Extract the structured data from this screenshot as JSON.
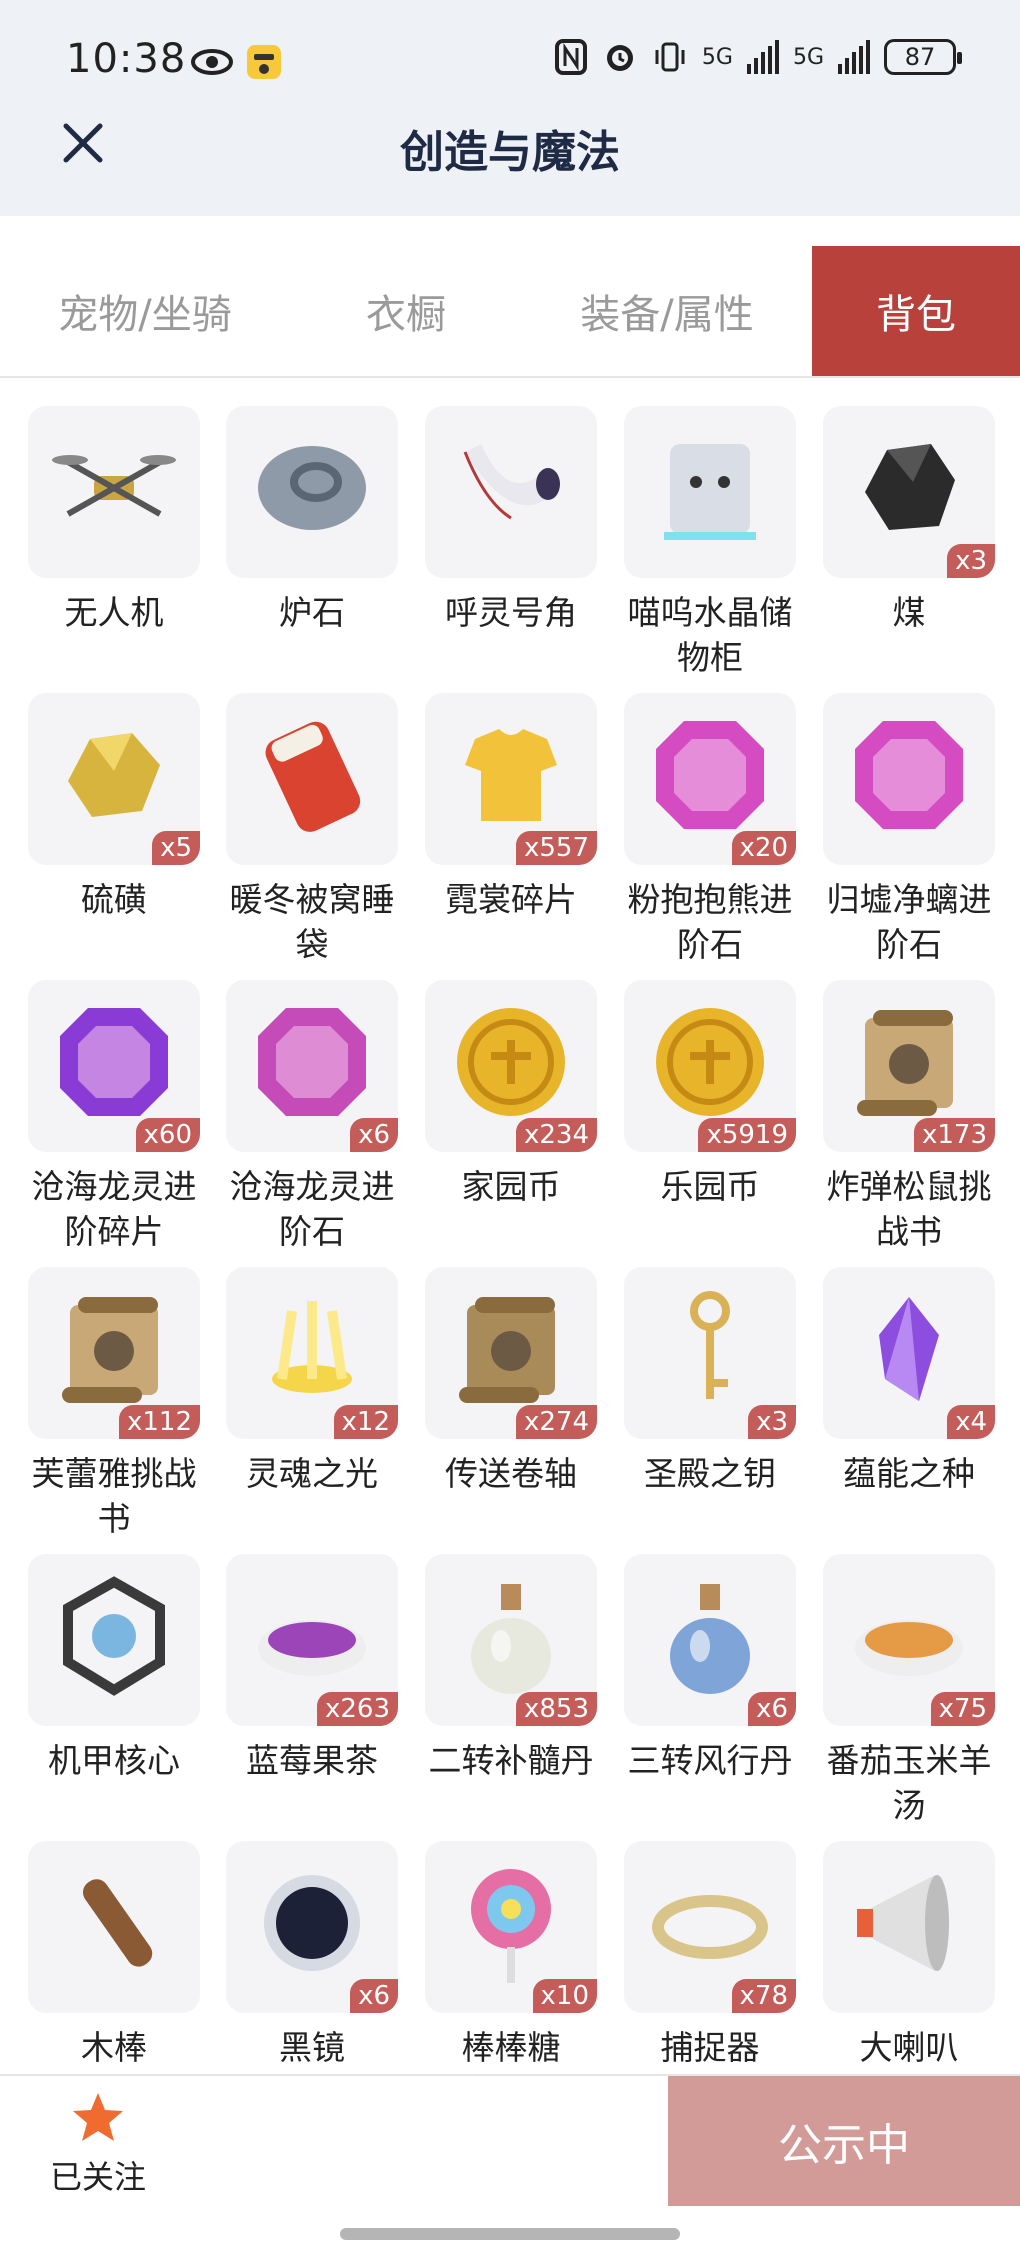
{
  "status_bar": {
    "time": "10:38",
    "battery": "87",
    "network_1": "5G",
    "network_2": "5G"
  },
  "header": {
    "title": "创造与魔法",
    "close_icon": "close-icon"
  },
  "tabs": [
    {
      "label": "宠物/坐骑",
      "active": false
    },
    {
      "label": "衣橱",
      "active": false
    },
    {
      "label": "装备/属性",
      "active": false
    },
    {
      "label": "背包",
      "active": true
    }
  ],
  "items": [
    {
      "name": "无人机",
      "count": "",
      "icon": "drone-icon",
      "color": "#c9a544"
    },
    {
      "name": "炉石",
      "count": "",
      "icon": "hearthstone-icon",
      "color": "#8e9aa8"
    },
    {
      "name": "呼灵号角",
      "count": "",
      "icon": "horn-icon",
      "color": "#b33a3a"
    },
    {
      "name": "喵呜水晶储物柜",
      "count": "",
      "icon": "cat-cabinet-icon",
      "color": "#d8dde6"
    },
    {
      "name": "煤",
      "count": "x3",
      "icon": "coal-icon",
      "color": "#2b2b2b"
    },
    {
      "name": "硫磺",
      "count": "x5",
      "icon": "sulfur-icon",
      "color": "#d7b43d"
    },
    {
      "name": "暖冬被窝睡袋",
      "count": "",
      "icon": "sleeping-bag-icon",
      "color": "#d9432f"
    },
    {
      "name": "霓裳碎片",
      "count": "x557",
      "icon": "clothes-shard-icon",
      "color": "#f2c33a"
    },
    {
      "name": "粉抱抱熊进阶石",
      "count": "x20",
      "icon": "pink-gem-icon",
      "color": "#d54bc2"
    },
    {
      "name": "归墟净螭进阶石",
      "count": "",
      "icon": "pink-gem-icon",
      "color": "#d54bc2"
    },
    {
      "name": "沧海龙灵进阶碎片",
      "count": "x60",
      "icon": "purple-gem-icon",
      "color": "#8a3bd6"
    },
    {
      "name": "沧海龙灵进阶石",
      "count": "x6",
      "icon": "purple-gem-icon",
      "color": "#c44bb8"
    },
    {
      "name": "家园币",
      "count": "x234",
      "icon": "coin-icon",
      "color": "#e8b52a"
    },
    {
      "name": "乐园币",
      "count": "x5919",
      "icon": "coin-icon",
      "color": "#e8b52a"
    },
    {
      "name": "炸弹松鼠挑战书",
      "count": "x173",
      "icon": "wanted-scroll-icon",
      "color": "#c8a877"
    },
    {
      "name": "芙蕾雅挑战书",
      "count": "x112",
      "icon": "wanted-scroll-icon",
      "color": "#c8a877"
    },
    {
      "name": "灵魂之光",
      "count": "x12",
      "icon": "soul-light-icon",
      "color": "#f5d64a"
    },
    {
      "name": "传送卷轴",
      "count": "x274",
      "icon": "teleport-scroll-icon",
      "color": "#a98a59"
    },
    {
      "name": "圣殿之钥",
      "count": "x3",
      "icon": "key-icon",
      "color": "#d9b257"
    },
    {
      "name": "蕴能之种",
      "count": "x4",
      "icon": "crystal-icon",
      "color": "#8d4ee0"
    },
    {
      "name": "机甲核心",
      "count": "",
      "icon": "mech-core-icon",
      "color": "#3a3a3a"
    },
    {
      "name": "蓝莓果茶",
      "count": "x263",
      "icon": "tea-icon",
      "color": "#9c45b8"
    },
    {
      "name": "二转补髓丹",
      "count": "x853",
      "icon": "potion-bottle-icon",
      "color": "#e7e9df"
    },
    {
      "name": "三转风行丹",
      "count": "x6",
      "icon": "potion-flask-icon",
      "color": "#7fa4d8"
    },
    {
      "name": "番茄玉米羊汤",
      "count": "x75",
      "icon": "soup-icon",
      "color": "#e59b45"
    },
    {
      "name": "木棒",
      "count": "",
      "icon": "club-icon",
      "color": "#8a5a35"
    },
    {
      "name": "黑镜",
      "count": "x6",
      "icon": "black-mirror-icon",
      "color": "#1d2138"
    },
    {
      "name": "棒棒糖",
      "count": "x10",
      "icon": "lollipop-icon",
      "color": "#e56fa5"
    },
    {
      "name": "捕捉器",
      "count": "x78",
      "icon": "catcher-icon",
      "color": "#d9c48a"
    },
    {
      "name": "大喇叭",
      "count": "",
      "icon": "megaphone-icon",
      "color": "#e0e0e0"
    }
  ],
  "bottom_bar": {
    "follow_label": "已关注",
    "publish_label": "公示中",
    "star_color": "#f06b2f"
  }
}
